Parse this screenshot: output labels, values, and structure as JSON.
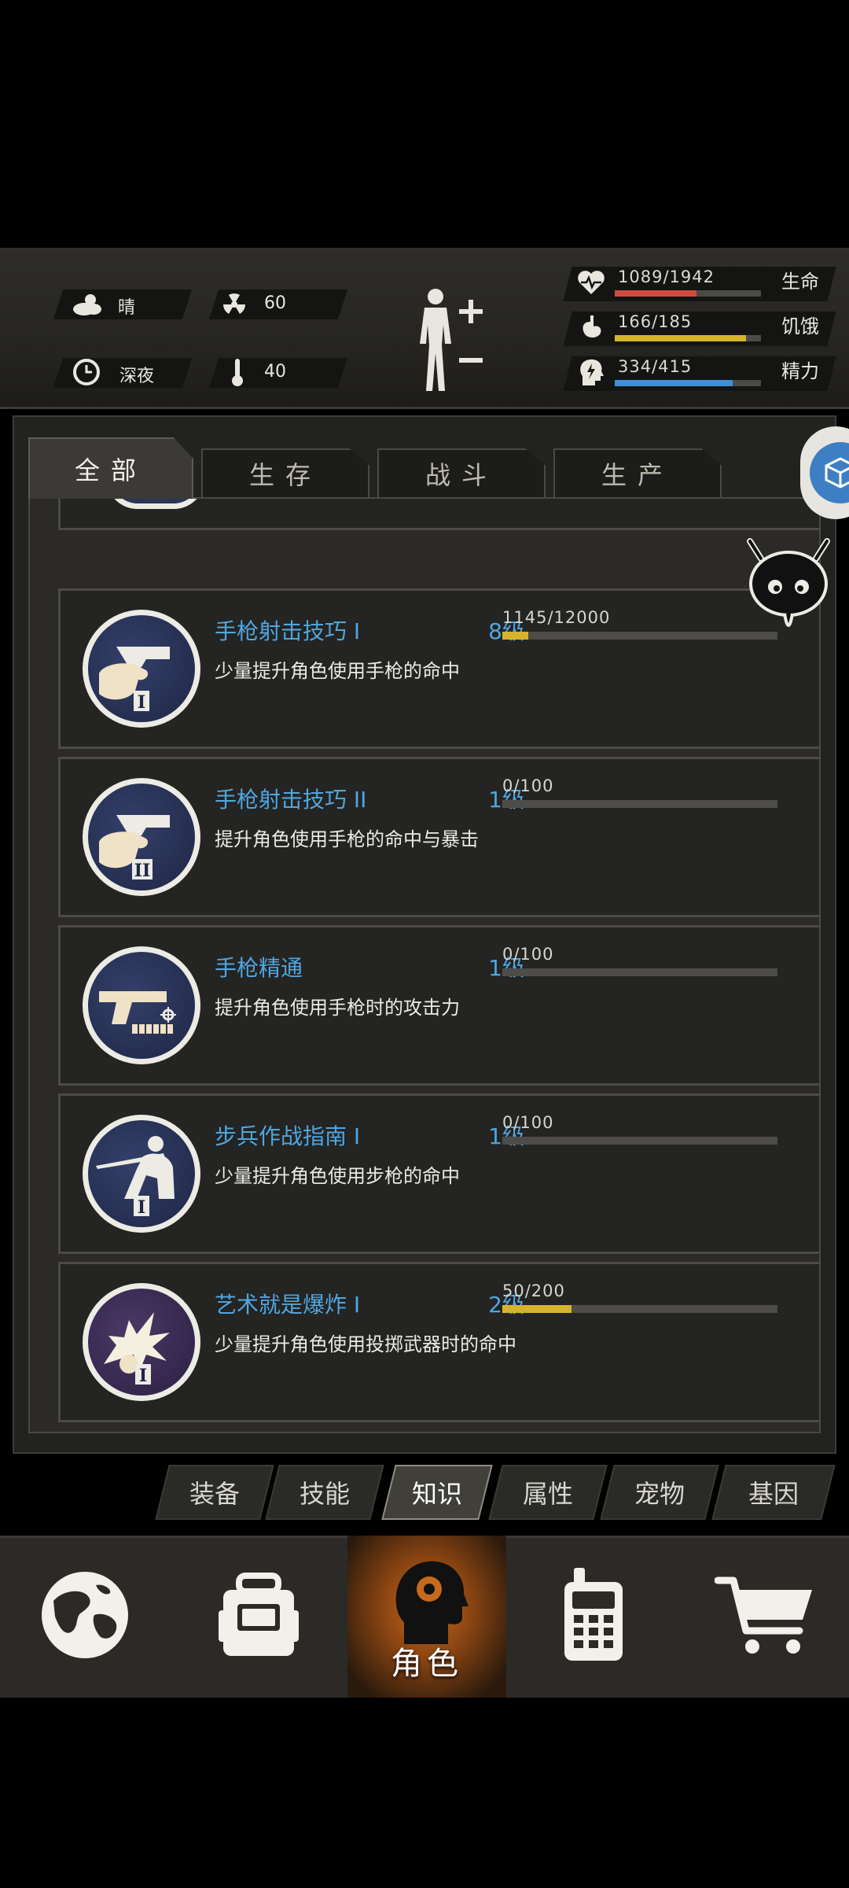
{
  "status": {
    "weather": {
      "icon": "cloud-sun-icon",
      "text": "晴"
    },
    "radiation": {
      "icon": "radiation-icon",
      "value": "60"
    },
    "time": {
      "icon": "clock-icon",
      "text": "深夜"
    },
    "temperature": {
      "icon": "thermometer-icon",
      "value": "40"
    },
    "body_icon": "body-figure-icon",
    "bars": [
      {
        "icon": "heart-pulse-icon",
        "value": "1089/1942",
        "label": "生命",
        "fraction": 0.561,
        "color": "#d14b3e"
      },
      {
        "icon": "stomach-icon",
        "value": "166/185",
        "label": "饥饿",
        "fraction": 0.897,
        "color": "#d6b32c"
      },
      {
        "icon": "head-bolt-icon",
        "value": "334/415",
        "label": "精力",
        "fraction": 0.805,
        "color": "#3e8fd6"
      }
    ]
  },
  "category_tabs": [
    "全部",
    "生存",
    "战斗",
    "生产"
  ],
  "active_category": "全部",
  "skills": [
    {
      "icon": "pistol-hand-icon",
      "title": "手枪射击技巧 I",
      "level": "8级",
      "progress_text": "1145/12000",
      "progress": 0.0954,
      "desc": "少量提升角色使用手枪的命中",
      "badge": "I"
    },
    {
      "icon": "pistol-hand-icon",
      "title": "手枪射击技巧 II",
      "level": "1级",
      "progress_text": "0/100",
      "progress": 0,
      "desc": "提升角色使用手枪的命中与暴击",
      "badge": "II"
    },
    {
      "icon": "pistol-mastery-icon",
      "title": "手枪精通",
      "level": "1级",
      "progress_text": "0/100",
      "progress": 0,
      "desc": "提升角色使用手枪时的攻击力",
      "badge": ""
    },
    {
      "icon": "rifleman-icon",
      "title": "步兵作战指南 I",
      "level": "1级",
      "progress_text": "0/100",
      "progress": 0,
      "desc": "少量提升角色使用步枪的命中",
      "badge": "I"
    },
    {
      "icon": "explosion-icon",
      "title": "艺术就是爆炸 I",
      "level": "2级",
      "progress_text": "50/200",
      "progress": 0.25,
      "desc": "少量提升角色使用投掷武器时的命中",
      "badge": "I"
    }
  ],
  "sub_tabs": [
    "装备",
    "技能",
    "知识",
    "属性",
    "宠物",
    "基因"
  ],
  "active_sub_tab": "知识",
  "nav": {
    "items": [
      {
        "icon": "globe-icon"
      },
      {
        "icon": "backpack-icon"
      },
      {
        "icon": "character-head-icon",
        "label": "角色"
      },
      {
        "icon": "walkie-talkie-icon"
      },
      {
        "icon": "shopping-cart-icon"
      }
    ]
  }
}
